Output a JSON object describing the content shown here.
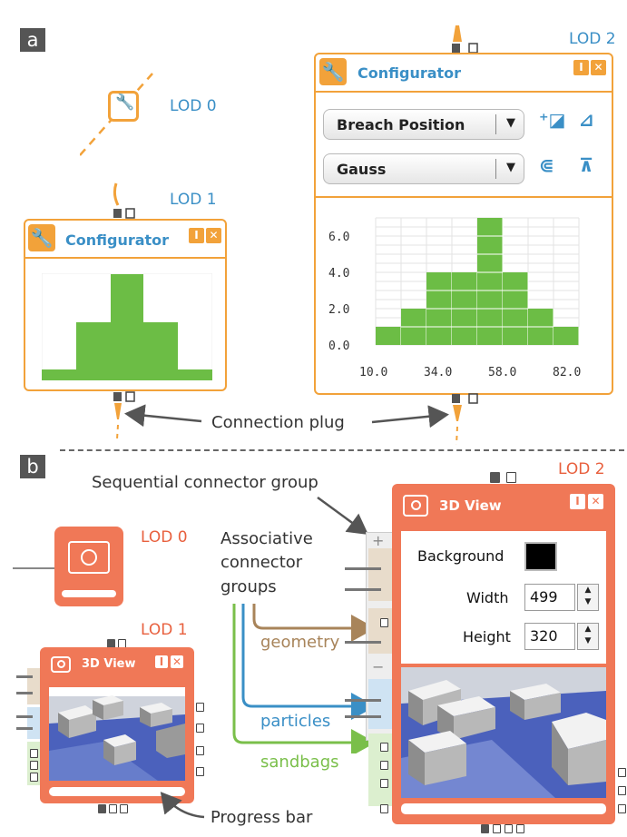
{
  "panel_a": {
    "tag": "a",
    "lod0_label": "LOD 0",
    "lod1_label": "LOD 1",
    "lod2_label": "LOD 2",
    "lod1_window": {
      "title": "Configurator"
    },
    "lod2_window": {
      "title": "Configurator",
      "dropdown1": "Breach Position",
      "dropdown2": "Gauss",
      "y_ticks": [
        "6.0",
        "4.0",
        "2.0",
        "0.0"
      ],
      "x_ticks": [
        "10.0",
        "34.0",
        "58.0",
        "82.0"
      ]
    },
    "connection_plug_label": "Connection plug",
    "colors": {
      "accent": "#f2a23a",
      "title": "#3a8fc6",
      "bars": "#6cbd45"
    }
  },
  "panel_b": {
    "tag": "b",
    "lod0_label": "LOD 0",
    "lod1_label": "LOD 1",
    "lod2_label": "LOD 2",
    "lod1_window": {
      "title": "3D View"
    },
    "lod2_window": {
      "title": "3D View",
      "background_label": "Background",
      "width_label": "Width",
      "width_value": "499",
      "height_label": "Height",
      "height_value": "320"
    },
    "sequential_label": "Sequential connector group",
    "associative_label_line1": "Associative",
    "associative_label_line2": "connector",
    "associative_label_line3": "groups",
    "geometry_label": "geometry",
    "particles_label": "particles",
    "sandbags_label": "sandbags",
    "progress_label": "Progress bar",
    "colors": {
      "accent": "#f07857",
      "geometry": "#a8845a",
      "particles": "#3a8fc6",
      "sandbags": "#7abf4a"
    }
  },
  "chart_data": [
    {
      "type": "bar",
      "x": [
        10,
        22,
        34,
        46,
        58,
        70,
        82,
        94
      ],
      "values": [
        1,
        2,
        4,
        4,
        7,
        4,
        2,
        1
      ],
      "xticks": [
        "10.0",
        "34.0",
        "58.0",
        "82.0"
      ],
      "yticks": [
        "0.0",
        "2.0",
        "4.0",
        "6.0"
      ],
      "ylim": [
        0,
        7
      ],
      "grid": true
    }
  ]
}
